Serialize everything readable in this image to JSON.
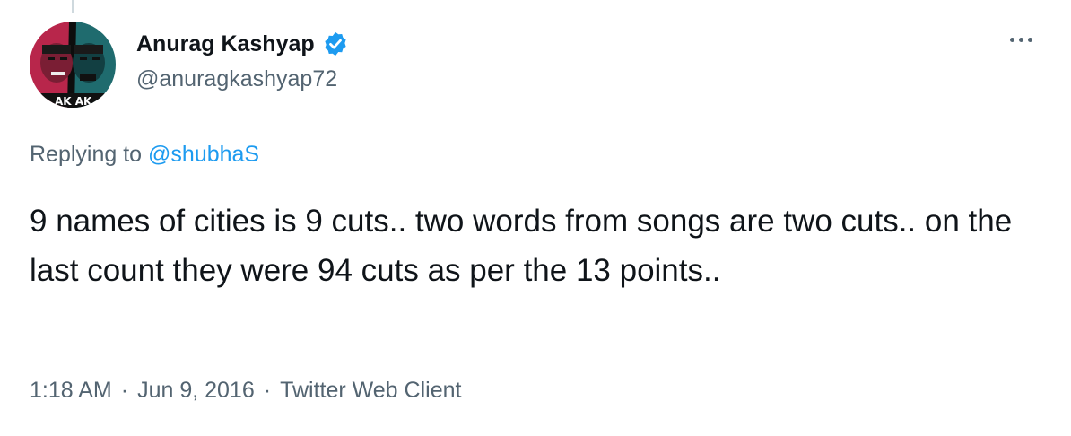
{
  "tweet": {
    "author": {
      "display_name": "Anurag Kashyap",
      "handle": "@anuragkashyap72",
      "verified": true,
      "avatar_text": "AK AK"
    },
    "replying_prefix": "Replying to",
    "replying_to": "@shubhaS",
    "text": "9 names of cities is 9 cuts.. two words from songs are two cuts.. on the last count they were 94 cuts as per the 13 points..",
    "time": "1:18 AM",
    "separator": "·",
    "date": "Jun 9, 2016",
    "client": "Twitter Web Client"
  },
  "colors": {
    "text_primary": "#0f1419",
    "text_secondary": "#536471",
    "link_blue": "#1d9bf0",
    "verified_blue": "#1d9bf0"
  },
  "icons": {
    "verified": "verified-badge-icon",
    "more": "more-options-icon"
  }
}
